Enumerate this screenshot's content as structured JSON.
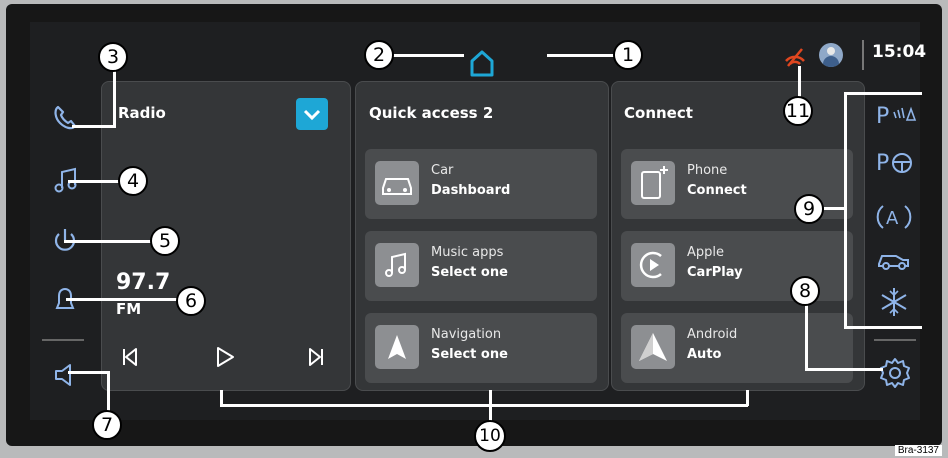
{
  "status_bar": {
    "time": "15:04"
  },
  "radio": {
    "title": "Radio",
    "frequency": "97.7",
    "band": "FM"
  },
  "quick_access": {
    "title": "Quick access 2",
    "tiles": [
      {
        "line1": "Car",
        "line2": "Dashboard",
        "icon": "car-icon"
      },
      {
        "line1": "Music apps",
        "line2": "Select one",
        "icon": "music-note-icon"
      },
      {
        "line1": "Navigation",
        "line2": "Select one",
        "icon": "navigation-arrow-icon"
      }
    ]
  },
  "connect": {
    "title": "Connect",
    "tiles": [
      {
        "line1": "Phone",
        "line2": "Connect",
        "icon": "phone-plus-icon"
      },
      {
        "line1": "Apple",
        "line2": "CarPlay",
        "icon": "carplay-icon"
      },
      {
        "line1": "Android",
        "line2": "Auto",
        "icon": "android-auto-icon"
      }
    ]
  },
  "callouts": [
    "1",
    "2",
    "3",
    "4",
    "5",
    "6",
    "7",
    "8",
    "9",
    "10",
    "11"
  ],
  "figure_id": "Bra-3137",
  "colors": {
    "accent": "#1ea7d6",
    "panel": "#343638",
    "tile": "#4a4c4e",
    "icon_blue": "#8fb4e8",
    "no_signal": "#e0461f"
  }
}
